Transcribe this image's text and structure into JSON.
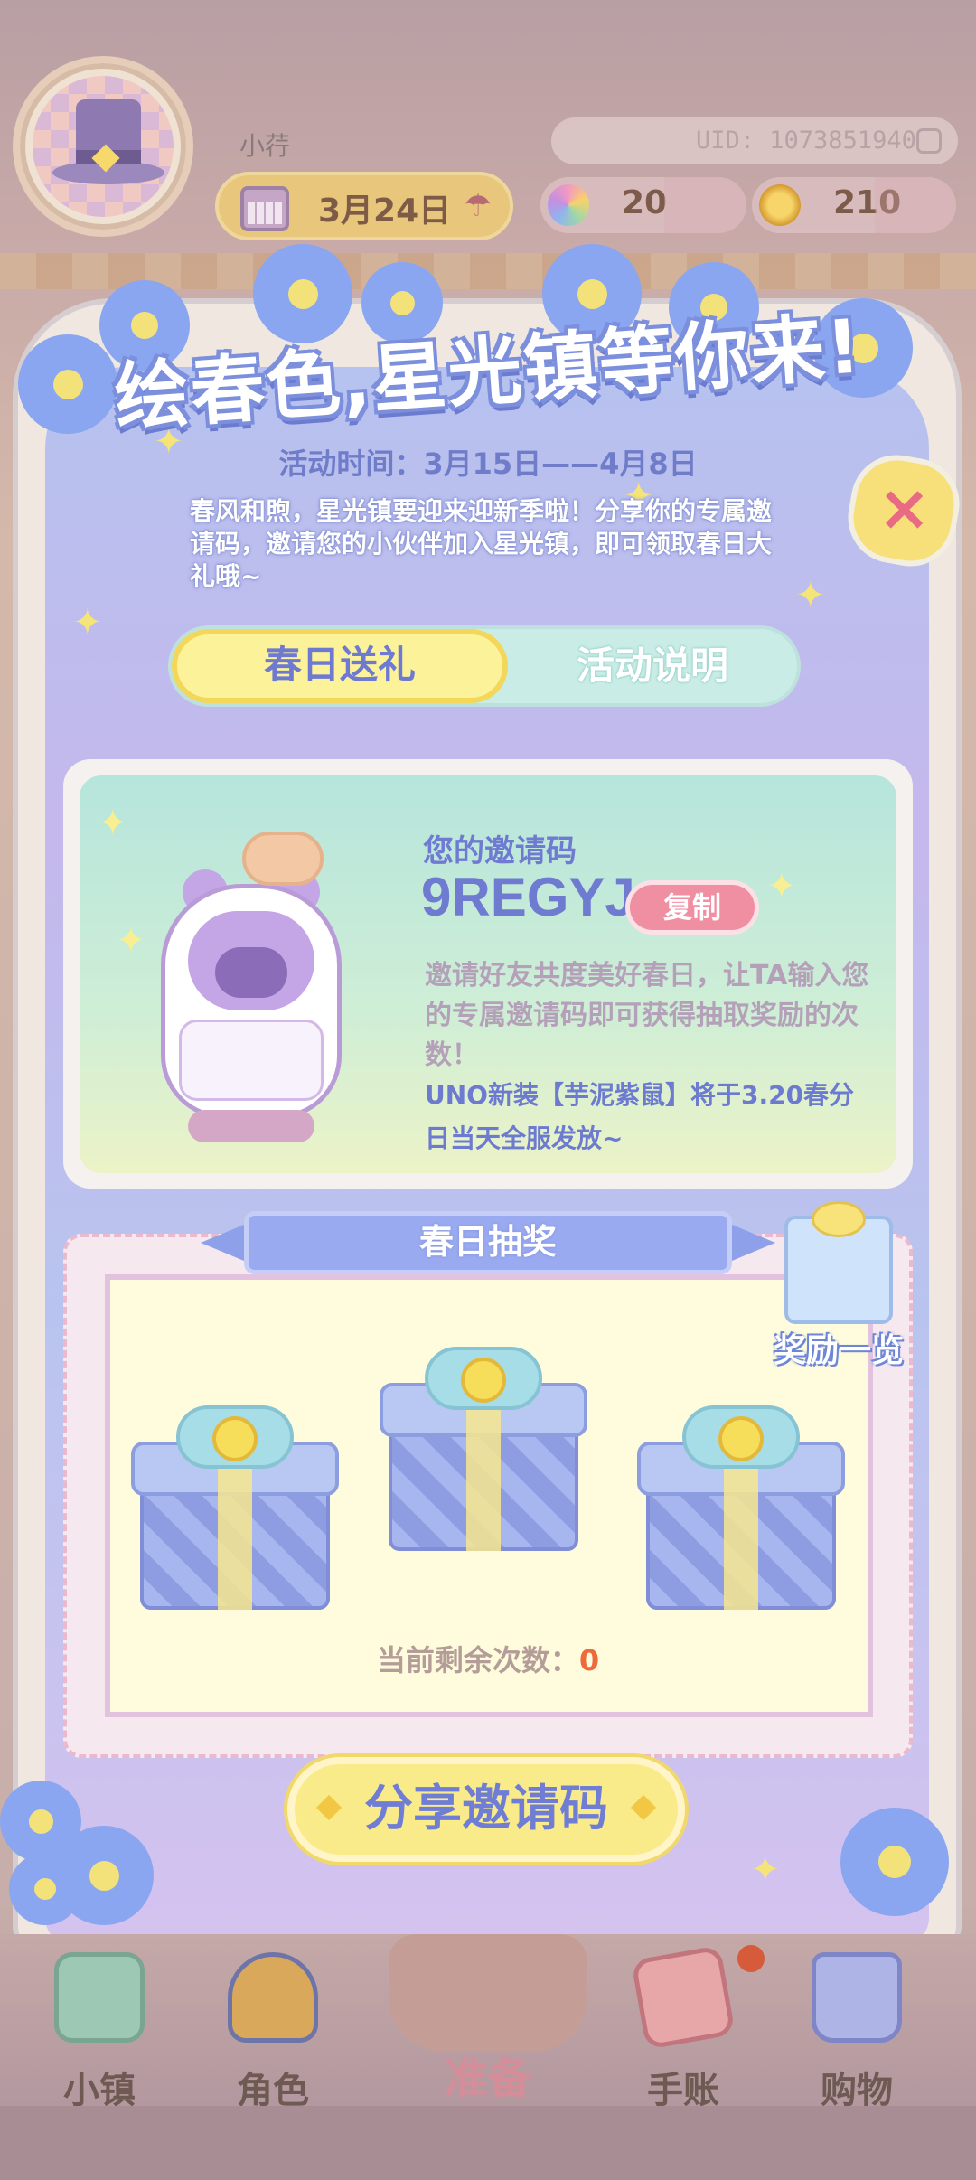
{
  "header": {
    "player_name": "小荇",
    "uid": "UID: 1073851940",
    "date": "3月24日",
    "stats": [
      {
        "icon": "flower-gem-icon",
        "value": "20",
        "color": "#c98fd9"
      },
      {
        "icon": "gold-coin-icon",
        "value": "210",
        "color": "#e2b44a"
      }
    ]
  },
  "event": {
    "title": "绘春色,星光镇等你来!",
    "time": "活动时间：3月15日——4月8日",
    "description": "春风和煦，星光镇要迎来迎新季啦！分享你的专属邀请码，邀请您的小伙伴加入星光镇，即可领取春日大礼哦~",
    "tabs": [
      {
        "label": "春日送礼",
        "active": true
      },
      {
        "label": "活动说明",
        "active": false
      }
    ]
  },
  "invite": {
    "label": "您的邀请码",
    "code": "9REGYJ",
    "copy_label": "复制",
    "text": "邀请好友共度美好春日，让TA输入您的专属邀请码即可获得抽取奖励的次数！",
    "notice": "UNO新装【芋泥紫鼠】将于3.20春分日当天全服发放~"
  },
  "lottery": {
    "title": "春日抽奖",
    "reward_label": "奖励一览",
    "remaining_label": "当前剩余次数：",
    "remaining_count": "0"
  },
  "share_label": "分享邀请码",
  "nav": [
    {
      "label": "小镇",
      "icon": "map-icon"
    },
    {
      "label": "角色",
      "icon": "character-icon"
    },
    {
      "label": "准备",
      "icon": "basket-icon"
    },
    {
      "label": "手账",
      "icon": "journal-icon"
    },
    {
      "label": "购物",
      "icon": "shopping-bag-icon"
    }
  ],
  "colors": {
    "accent_blue": "#6f7bd1",
    "button_pink": "#f08ea2",
    "button_yellow": "#f9eb8a",
    "count_orange": "#ee6a3b"
  }
}
